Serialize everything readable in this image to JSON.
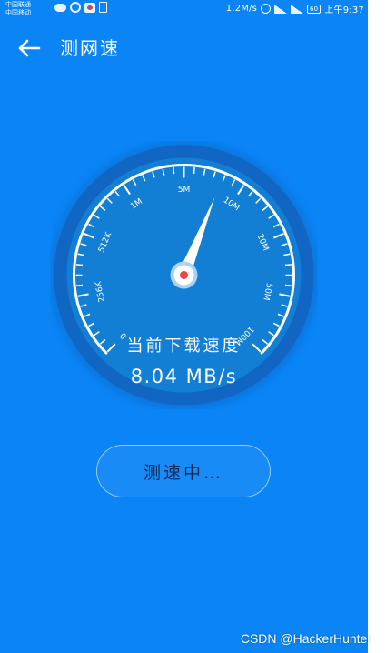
{
  "status_bar": {
    "carrier_1": "中国联通",
    "carrier_2": "中国移动",
    "net_speed": "1.2M/s",
    "battery": "60",
    "time": "上午9:37"
  },
  "header": {
    "title": "测网速"
  },
  "gauge": {
    "tick_labels": [
      "0",
      "256K",
      "512K",
      "1M",
      "5M",
      "10M",
      "20M",
      "50M",
      "100M"
    ],
    "needle_position": 0.58,
    "caption": "当前下载速度",
    "speed": "8.04 MB/s"
  },
  "action": {
    "status_label": "测速中…"
  },
  "watermark": "CSDN @HackerHunter",
  "colors": {
    "background": "#0b84f6",
    "dial_outer": "#1166c4",
    "dial_inner": "#127fd4",
    "needle_dot": "#e8463e"
  }
}
